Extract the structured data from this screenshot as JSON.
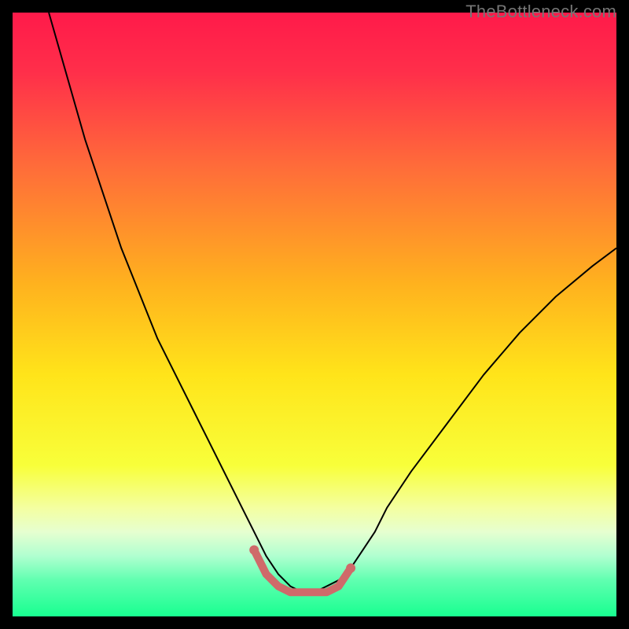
{
  "watermark": "TheBottleneck.com",
  "chart_data": {
    "type": "line",
    "title": "",
    "xlabel": "",
    "ylabel": "",
    "xlim": [
      0,
      100
    ],
    "ylim": [
      0,
      100
    ],
    "grid": false,
    "legend": false,
    "background_gradient": {
      "stops": [
        {
          "offset": 0.0,
          "color": "#ff1a4a"
        },
        {
          "offset": 0.1,
          "color": "#ff2f4a"
        },
        {
          "offset": 0.25,
          "color": "#ff6a3a"
        },
        {
          "offset": 0.45,
          "color": "#ffb21e"
        },
        {
          "offset": 0.6,
          "color": "#ffe41a"
        },
        {
          "offset": 0.75,
          "color": "#f8ff3a"
        },
        {
          "offset": 0.82,
          "color": "#f4ffa0"
        },
        {
          "offset": 0.86,
          "color": "#e6ffd0"
        },
        {
          "offset": 0.9,
          "color": "#b0ffd0"
        },
        {
          "offset": 0.94,
          "color": "#60ffb0"
        },
        {
          "offset": 1.0,
          "color": "#18ff90"
        }
      ]
    },
    "series": [
      {
        "name": "bottleneck-curve",
        "type": "line",
        "stroke": "#000000",
        "stroke_width": 2,
        "x": [
          6,
          8,
          10,
          12,
          14,
          16,
          18,
          20,
          22,
          24,
          26,
          28,
          30,
          32,
          34,
          36,
          38,
          40,
          42,
          44,
          46,
          48,
          50,
          52,
          54,
          56,
          58,
          60,
          62,
          66,
          72,
          78,
          84,
          90,
          96,
          100
        ],
        "values": [
          100,
          93,
          86,
          79,
          73,
          67,
          61,
          56,
          51,
          46,
          42,
          38,
          34,
          30,
          26,
          22,
          18,
          14,
          10,
          7,
          5,
          4,
          4,
          5,
          6,
          8,
          11,
          14,
          18,
          24,
          32,
          40,
          47,
          53,
          58,
          61
        ]
      },
      {
        "name": "optimal-range-highlight",
        "type": "line",
        "stroke": "#cf6a6a",
        "stroke_width": 10,
        "stroke_linecap": "round",
        "x": [
          40,
          42,
          44,
          46,
          48,
          50,
          52,
          54,
          56
        ],
        "values": [
          11,
          7,
          5,
          4,
          4,
          4,
          4,
          5,
          8
        ]
      }
    ],
    "markers": [
      {
        "name": "left-end-dot",
        "x": 40,
        "y": 11,
        "r": 6,
        "fill": "#cf6a6a"
      },
      {
        "name": "right-end-dot",
        "x": 56,
        "y": 8,
        "r": 6,
        "fill": "#cf6a6a"
      }
    ]
  }
}
